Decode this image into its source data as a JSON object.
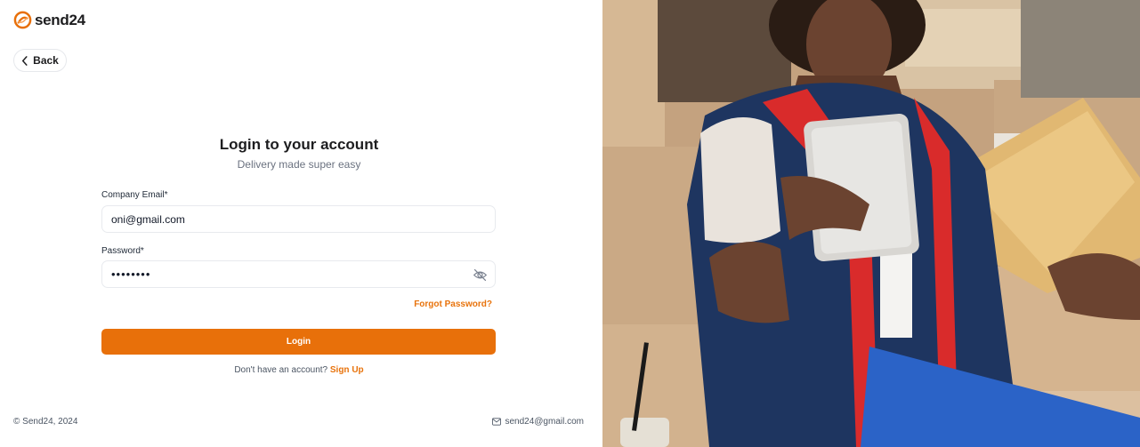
{
  "brand": {
    "logo_text": "send24",
    "accent_color": "#E8700A"
  },
  "nav": {
    "back_label": "Back",
    "back_icon": "chevron-left-icon"
  },
  "login": {
    "title": "Login to your account",
    "subtitle": "Delivery made super easy",
    "email_label": "Company Email",
    "email_value": "oni@gmail.com",
    "password_label": "Password",
    "password_value": "••••••••",
    "required_marker": "*",
    "password_toggle_icon": "eye-off-icon",
    "forgot_label": "Forgot Password?",
    "submit_label": "Login",
    "signup_prompt": "Don't have an account?",
    "signup_link": "Sign Up"
  },
  "footer": {
    "copyright": "© Send24, 2024",
    "email_icon": "mail-icon",
    "contact_email": "send24@gmail.com"
  },
  "hero": {
    "image": "delivery-worker-with-tablet-and-packages-photo"
  }
}
